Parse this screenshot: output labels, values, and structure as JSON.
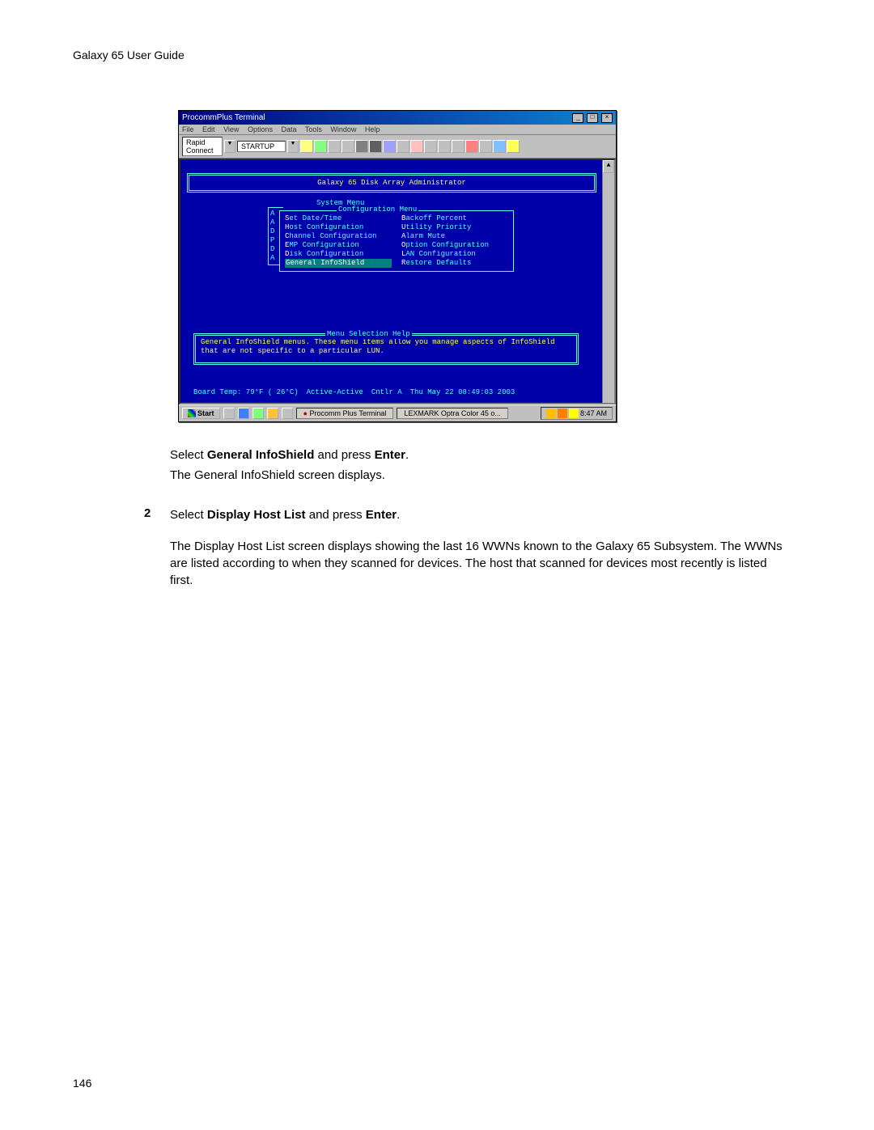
{
  "header": "Galaxy 65 User Guide",
  "page_number": "146",
  "screenshot": {
    "window_title": "ProcommPlus Terminal",
    "menubar": [
      "File",
      "Edit",
      "View",
      "Options",
      "Data",
      "Tools",
      "Window",
      "Help"
    ],
    "toolbar_left": "Rapid Connect",
    "toolbar_dd": "STARTUP",
    "term_title": "Galaxy 65 Disk Array Administrator",
    "system_menu_label": "System Menu",
    "sys_underlay": [
      "A",
      "A",
      "D",
      "P",
      "D",
      "A"
    ],
    "config_menu_label": "Configuration Menu",
    "config_left": [
      {
        "hot": "S",
        "rest": "et Date/Time"
      },
      {
        "hot": "H",
        "rest": "ost Configuration"
      },
      {
        "hot": "C",
        "rest": "hannel Configuration"
      },
      {
        "hot": "E",
        "rest": "MP Configuration"
      },
      {
        "hot": "D",
        "rest": "isk Configuration"
      },
      {
        "hot": "G",
        "rest": "eneral InfoShield",
        "selected": true
      }
    ],
    "config_right": [
      {
        "hot": "B",
        "rest": "ackoff Percent"
      },
      {
        "hot": "U",
        "rest": "tility Priority"
      },
      {
        "hot": "A",
        "rest": "larm Mute"
      },
      {
        "hot": "O",
        "rest": "ption Configuration"
      },
      {
        "hot": "L",
        "rest": "AN Configuration"
      },
      {
        "hot": "R",
        "rest": "estore Defaults"
      }
    ],
    "help_label": "Menu Selection Help",
    "help_text": "General InfoShield menus.  These menu items allow you manage aspects of InfoShield that are not specific to a particular LUN.",
    "status": {
      "temp": "Board Temp:  79°F ( 26°C)",
      "mode": "Active-Active",
      "ctrl": "Cntlr A",
      "time": "Thu May 22 08:49:03 2003"
    },
    "taskbar": {
      "start": "Start",
      "task1": "Procomm Plus Terminal",
      "task2": "LEXMARK Optra Color 45 o...",
      "clock": "8:47 AM"
    }
  },
  "instructions": {
    "line1_pre": "Select ",
    "line1_bold": "General InfoShield",
    "line1_mid": " and press ",
    "line1_bold2": "Enter",
    "line1_post": ".",
    "line2": "The General InfoShield screen displays.",
    "step2_num": "2",
    "step2_pre": "Select ",
    "step2_bold": "Display Host List",
    "step2_mid": " and press ",
    "step2_bold2": "Enter",
    "step2_post": ".",
    "step2_para": "The Display Host List screen displays showing the last 16 WWNs known to the Galaxy 65 Subsystem. The WWNs are listed according to when they scanned for devices. The host that scanned for devices most recently is listed first."
  }
}
